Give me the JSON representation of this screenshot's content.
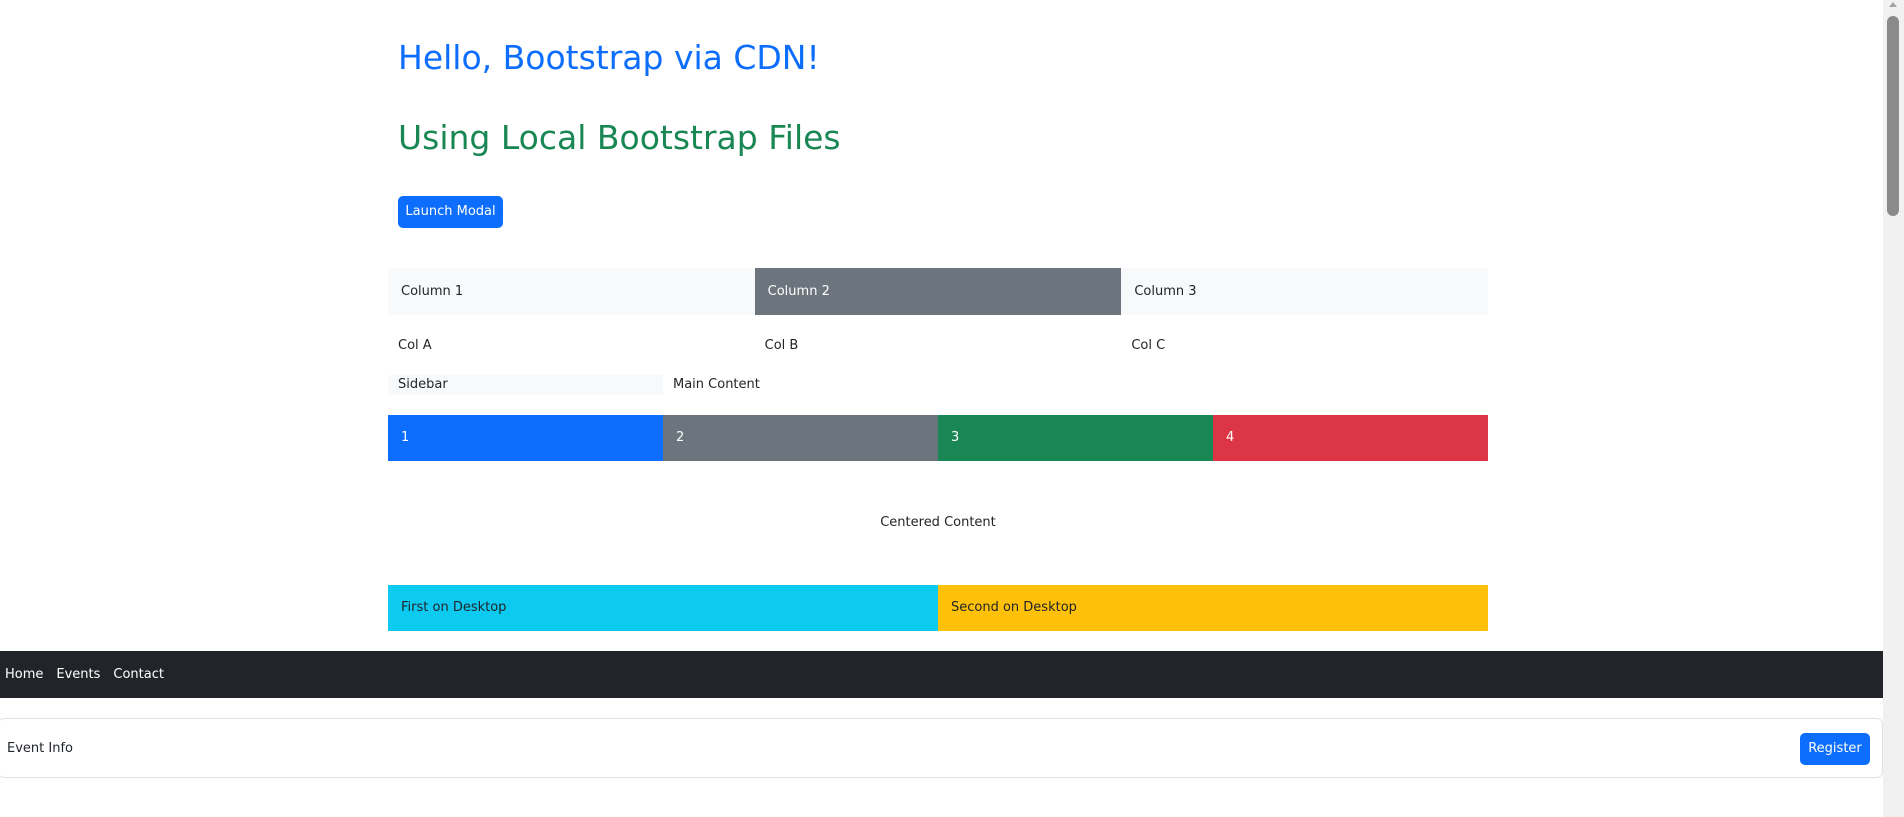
{
  "headings": {
    "cdn": "Hello, Bootstrap via CDN!",
    "local": "Using Local Bootstrap Files"
  },
  "modal_button": {
    "label": "Launch Modal"
  },
  "grid_columns": [
    "Column 1",
    "Column 2",
    "Column 3"
  ],
  "grid_abc": [
    "Col A",
    "Col B",
    "Col C"
  ],
  "layout": {
    "sidebar": "Sidebar",
    "main": "Main Content"
  },
  "numbered": [
    "1",
    "2",
    "3",
    "4"
  ],
  "centered": "Centered Content",
  "ordered": [
    "First on Desktop",
    "Second on Desktop"
  ],
  "nav": {
    "items": [
      "Home",
      "Events",
      "Contact"
    ]
  },
  "card": {
    "label": "Event Info",
    "button": "Register"
  },
  "colors": {
    "primary": "#0d6efd",
    "secondary": "#6c757d",
    "success": "#198754",
    "danger": "#dc3545",
    "info": "#0dcaf0",
    "warning": "#ffc107",
    "light": "#f8f9fa",
    "dark": "#212529"
  }
}
